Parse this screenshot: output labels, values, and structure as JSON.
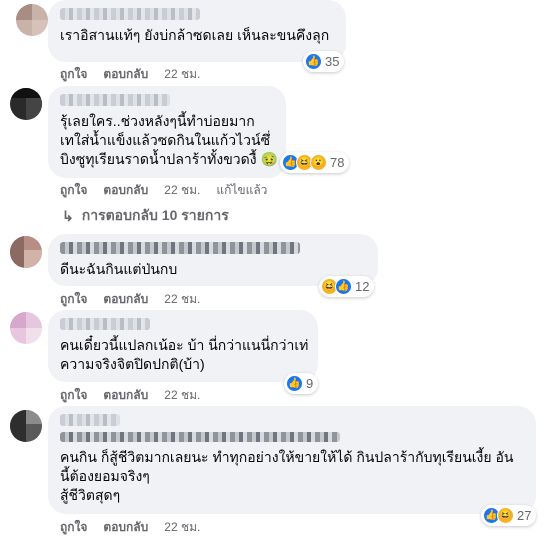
{
  "comments": [
    {
      "text_lines": [
        "เราอิสานแท้ๆ ยังบ่กล้าซดเลย เห็นละขนคึงลุก"
      ],
      "reactions": [
        "like"
      ],
      "reaction_count": "35",
      "like_label": "ถูกใจ",
      "reply_label": "ตอบกลับ",
      "time": "22 ชม."
    },
    {
      "text_lines": [
        "รุ้เลยใคร..ช่วงหลังๆนี้ทำบ่อยมาก",
        "เทใส่น้ำแข็งแล้วซดกินในแก้วไวน์ซึ่",
        "บิงซูทุเรียนราดน้ำปลาร้าทั้งขวดงื้ 🤢"
      ],
      "reactions": [
        "like",
        "haha",
        "wow"
      ],
      "reaction_count": "78",
      "like_label": "ถูกใจ",
      "reply_label": "ตอบกลับ",
      "time": "22 ชม.",
      "edited_label": "แก้ไขแล้ว",
      "replies_label": "การตอบกลับ 10 รายการ"
    },
    {
      "text_lines": [
        "ดีนะฉันกินแต่ป่นกบ"
      ],
      "reactions": [
        "haha",
        "like"
      ],
      "reaction_count": "12",
      "like_label": "ถูกใจ",
      "reply_label": "ตอบกลับ",
      "time": "22 ชม."
    },
    {
      "text_lines": [
        "คนเดี๋ยวนี้แปลกเน้อะ บ้า นี่กว่าแนนี่กว่าเท่",
        "ความจริงจิตปิดปกติ(บ้า)"
      ],
      "reactions": [
        "like"
      ],
      "reaction_count": "9",
      "like_label": "ถูกใจ",
      "reply_label": "ตอบกลับ",
      "time": "22 ชม."
    },
    {
      "text_lines": [
        "คนกิน ก็สู้ชีวิตมากเลยนะ ทำทุกอย่างให้ขายให้ได้ กินปลาร้ากับทุเรียนเงี้ย อัน",
        "นี้ต้องยอมจริงๆ",
        "สู้ชีวิตสุดๆ"
      ],
      "reactions": [
        "like",
        "haha"
      ],
      "reaction_count": "27",
      "like_label": "ถูกใจ",
      "reply_label": "ตอบกลับ",
      "time": "22 ชม."
    }
  ],
  "icons": {
    "like": "👍",
    "haha": "😆",
    "wow": "😮",
    "reply_arrow": "↳"
  },
  "colors": {
    "bubble": "#f0f2f5",
    "like": "#1877f2",
    "meta_text": "#65676b"
  }
}
